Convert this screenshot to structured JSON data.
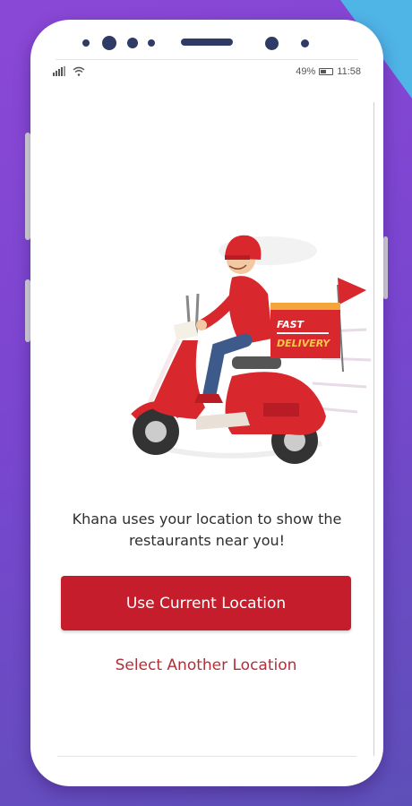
{
  "status_bar": {
    "signal_icon": "signal-icon",
    "wifi_icon": "wifi-icon",
    "battery_percent": "49%",
    "battery_level": 0.49,
    "time": "11:58"
  },
  "illustration": {
    "icon": "delivery-scooter-illustration",
    "box_text_line1": "FAST",
    "box_text_line2": "DELIVERY"
  },
  "message": {
    "line1": "Khana uses your location to show the",
    "line2": "restaurants near you!"
  },
  "actions": {
    "primary_label": "Use Current Location",
    "secondary_label": "Select Another Location"
  },
  "colors": {
    "primary": "#c51d2b",
    "link": "#b0303a",
    "background_purple": "#8b48d6",
    "accent_blue": "#4fb5e6"
  }
}
